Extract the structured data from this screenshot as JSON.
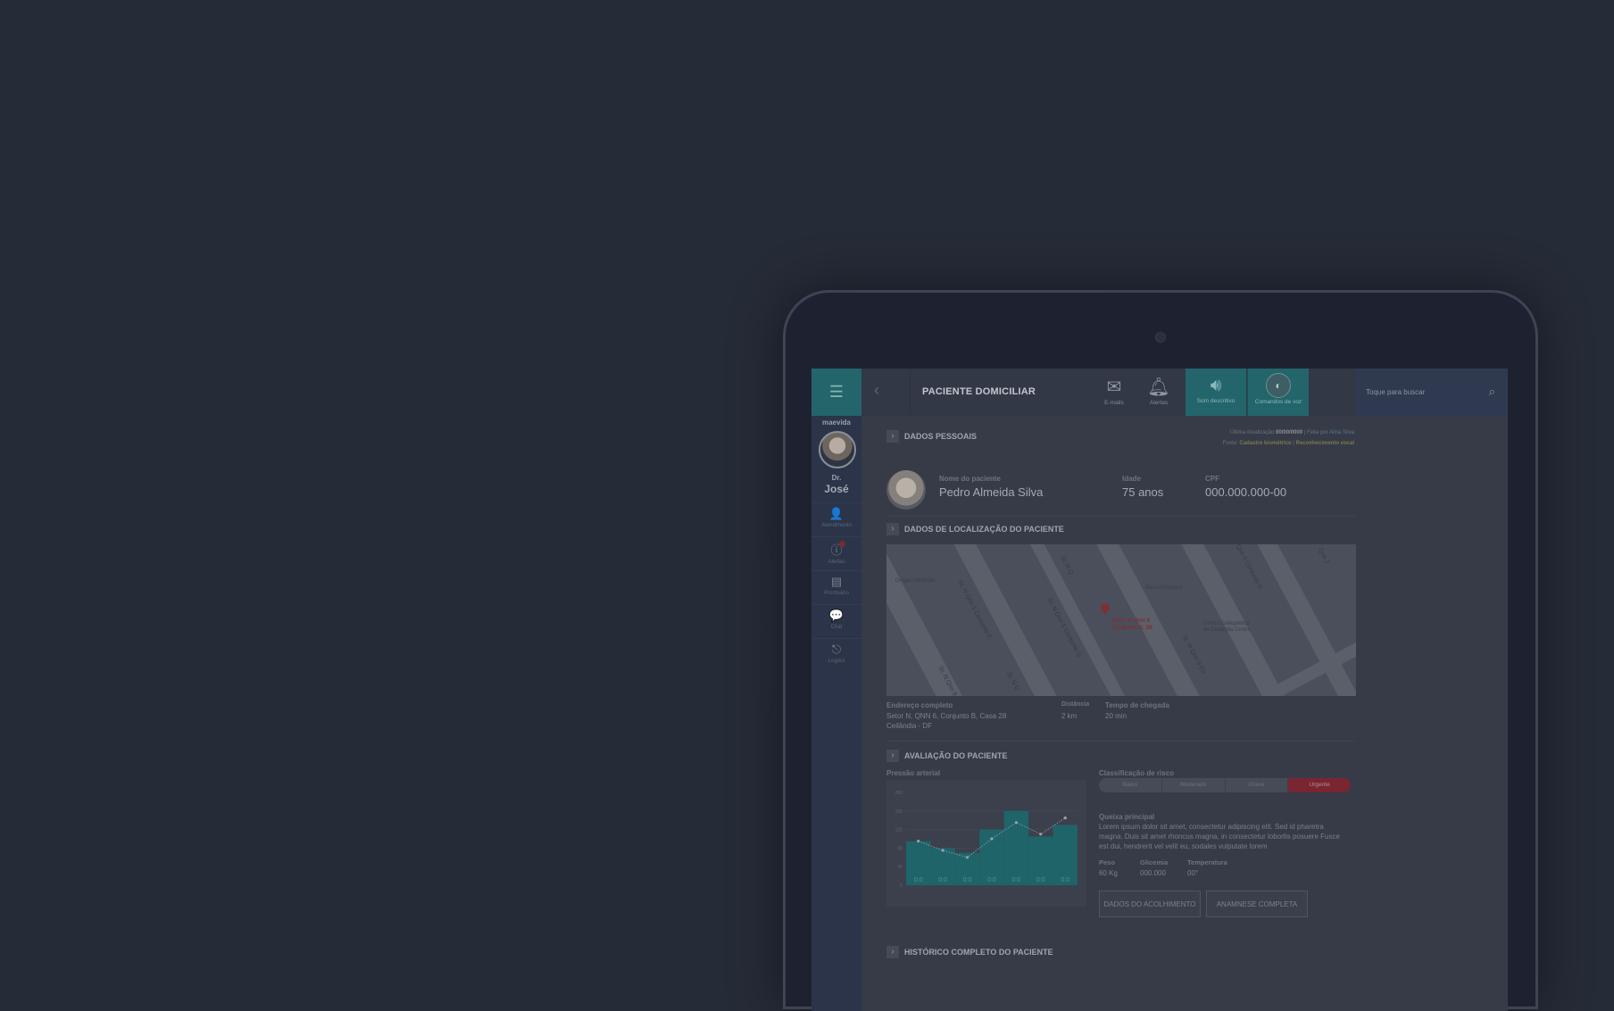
{
  "sidebar": {
    "brand": "maevida",
    "doctor_title": "Dr.",
    "doctor_name": "José",
    "items": [
      {
        "icon": "user-icon",
        "label": "Atendimento"
      },
      {
        "icon": "alert-icon",
        "label": "Alertas"
      },
      {
        "icon": "clipboard-icon",
        "label": "Prontuário"
      },
      {
        "icon": "chat-icon",
        "label": "Chat"
      },
      {
        "icon": "logout-icon",
        "label": "Logout"
      }
    ]
  },
  "topbar": {
    "title": "PACIENTE DOMICILIAR",
    "email_label": "E-mails",
    "alerts_label": "Alertas",
    "audio_label": "Som descritivo",
    "voice_label": "Comandos de voz",
    "search_placeholder": "Toque para buscar"
  },
  "personal": {
    "section_title": "DADOS PESSOAIS",
    "last_update_label": "Última Atualização",
    "last_update_value": "00/00/0000",
    "made_by_label": "Feita por",
    "made_by_value": "Alina Silva",
    "source_label": "Fonte:",
    "source_1": "Cadastro biométrico",
    "source_2": "Reconhecimento vocal",
    "name_label": "Nome do paciente",
    "name_value": "Pedro Almeida Silva",
    "age_label": "Idade",
    "age_value": "75 anos",
    "cpf_label": "CPF",
    "cpf_value": "000.000.000-00"
  },
  "location": {
    "section_title": "DADOS DE LOCALIZAÇÃO DO PACIENTE",
    "map_streets": [
      "St. N Qnn 8",
      "St. N Qnn 5 Conjunto E",
      "St. N Qnn 5 Conjunto G",
      "St. M Qnn 5 Co",
      "St. N Q",
      "St. N Q",
      "Qnn 5 Conjunto D",
      "Qnn 7"
    ],
    "pin_label_1": "Setor N Qnn 6",
    "pin_label_2": "Conjunto B, 28",
    "poi_1": "Drogal Ceilândia",
    "poi_2": "Bacu Alimentos",
    "poi_3": "Centro Catequético",
    "poi_4": "de Ceilândia Centro",
    "address_label": "Endereço completo",
    "address_line1": "Setor N, QNN 6, Conjunto B, Casa 28",
    "address_line2": "Ceilândia - DF",
    "distance_label": "Distância",
    "distance_value": "2 km",
    "arrival_label": "Tempo de chegada",
    "arrival_value": "20 min"
  },
  "evaluation": {
    "section_title": "AVALIAÇÃO DO PACIENTE",
    "pressure_label": "Pressão arterial",
    "risk_label": "Classificação de risco",
    "risk_levels": [
      "Baixo",
      "Moderado",
      "Grave",
      "Urgente"
    ],
    "risk_active": "Urgente",
    "complaint_title": "Queixa principal",
    "complaint_text": "Lorem ipsum dolor sit amet, consectetur adipiscing elit. Sed id pharetra magna. Duis sit amet rhoncus magna, in consectetur lobortis posuere Fusce est dui, hendrerit vel velit eu, sodales vulputate lorem",
    "weight_label": "Peso",
    "weight_value": "60 Kg",
    "glucose_label": "Glicemia",
    "glucose_value": "000.000",
    "temp_label": "Temperatura",
    "temp_value": "00°",
    "btn_intake": "DADOS DO ACOLHIMENTO",
    "btn_anamnesis": "ANAMNESE COMPLETA",
    "next_section_title": "HISTÓRICO COMPLETO DO PACIENTE"
  },
  "chart_data": {
    "type": "bar",
    "title": "Pressão arterial",
    "y_ticks": [
      "200",
      "160",
      "120",
      "80",
      "40",
      "0"
    ],
    "ylim": [
      0,
      200
    ],
    "bar_labels": [
      "0:0",
      "0:0",
      "0:0",
      "0:0",
      "0:0",
      "0:0",
      "0:0"
    ],
    "values": [
      95,
      80,
      70,
      120,
      160,
      105,
      130
    ],
    "trend": [
      95,
      75,
      60,
      100,
      135,
      110,
      145
    ],
    "bar_color": "#1f6468",
    "trend_color": "#9aa0ad"
  },
  "colors": {
    "teal": "#23656a",
    "urgent": "#7a2532",
    "background": "#262b38"
  }
}
